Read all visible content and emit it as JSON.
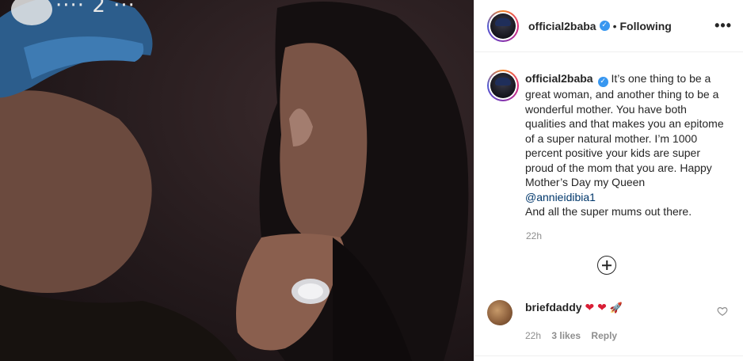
{
  "post": {
    "username": "official2baba",
    "verified_mark": "✓",
    "separator": "•",
    "following_label": "Following",
    "more_label": "•••",
    "photo_text_fragment": "···· 2 ···"
  },
  "caption": {
    "username": "official2baba",
    "text_before_mention": "It’s one thing to be a great woman, and another thing to be a wonderful mother. You have both qualities and that makes you an epitome of a super natural mother. I’m 1000 percent positive your kids are super proud of the mom that you are. Happy Mother’s Day my Queen",
    "mention": "@annieidibia1",
    "text_after_mention": "And all the super mums out there.",
    "timestamp": "22h"
  },
  "load_more": {
    "icon": "plus-circle-icon"
  },
  "comments": [
    {
      "username": "briefdaddy",
      "hearts": "❤ ❤",
      "rocket": "🚀",
      "time": "22h",
      "likes": "3 likes",
      "reply_label": "Reply"
    }
  ],
  "colors": {
    "text": "#262626",
    "muted": "#8e8e8e",
    "link": "#00376b",
    "verified": "#3897f0",
    "heart": "#d91e35"
  }
}
